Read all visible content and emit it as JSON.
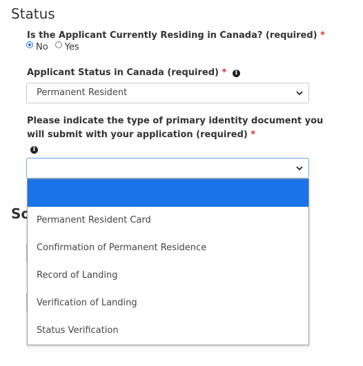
{
  "status_section": {
    "title": "Status",
    "residing": {
      "question": "Is the Applicant Currently Residing in Canada? (required)",
      "required_marker": "*",
      "options": [
        {
          "label": "No",
          "checked": true
        },
        {
          "label": "Yes",
          "checked": false
        }
      ]
    },
    "applicant_status": {
      "label": "Applicant Status in Canada (required)",
      "required_marker": "*",
      "info_icon": "info-icon",
      "selected_value": "Permanent Resident"
    },
    "identity_document": {
      "label_line1": "Please indicate the type of primary identity document you",
      "label_line2": "will submit with your application (required)",
      "required_marker": "*",
      "info_icon": "info-icon",
      "selected_value": "",
      "options": [
        "",
        "Permanent Resident Card",
        "Confirmation of Permanent Residence",
        "Record of Landing",
        "Verification of Landing",
        "Status Verification"
      ]
    }
  },
  "next_section": {
    "title_partial": "So"
  },
  "colors": {
    "required": "#d6322b",
    "highlight": "#1a73e8",
    "focus_border": "#66a3e0"
  }
}
